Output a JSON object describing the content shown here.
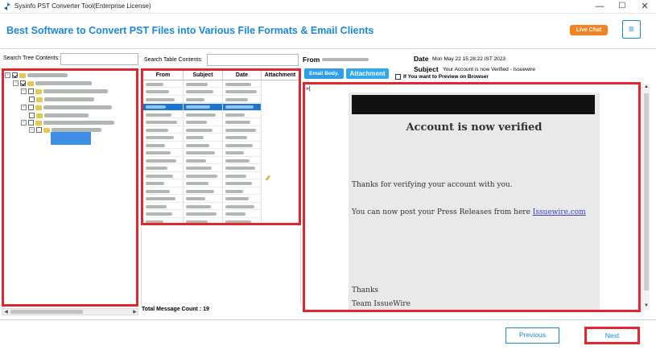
{
  "window": {
    "title": "Sysinfo PST Converter Tool(Enterprise License)",
    "minimize": "—",
    "maximize": "☐",
    "close": "✕"
  },
  "header": {
    "headline": "Best Software to Convert PST Files into Various File Formats & Email Clients",
    "live_chat": "Live Chat",
    "menu_icon": "≡"
  },
  "tree": {
    "search_label": "Search Tree Contents:"
  },
  "table": {
    "search_label": "Search Table Contents:",
    "columns": [
      "From",
      "Subject",
      "Date",
      "Attachment"
    ],
    "total_count": "Total Message Count : 19"
  },
  "email": {
    "from_label": "From",
    "date_label": "Date",
    "date_value": "Mon May 22 15:28:22 IST 2023",
    "subject_label": "Subject",
    "subject_value": "Your Account is now Verified - Issuewire",
    "email_body_button": "Email Body.",
    "attachment_button": "Attachment",
    "preview_label": "If You want to Preview on Browser",
    "preview_corner": "»|",
    "heading": "Account is now verified",
    "line1": "Thanks for verifying your account with you.",
    "line2_prefix": "You can now post your Press Releases from here ",
    "line2_link": "Issuewire.com",
    "signoff1": "Thanks",
    "signoff2": "Team IssueWire"
  },
  "footer": {
    "previous": "Previous",
    "next": "Next"
  },
  "colors": {
    "accent": "#1a88d8",
    "highlight_border": "#e0262e",
    "live_chat": "#f58220"
  }
}
